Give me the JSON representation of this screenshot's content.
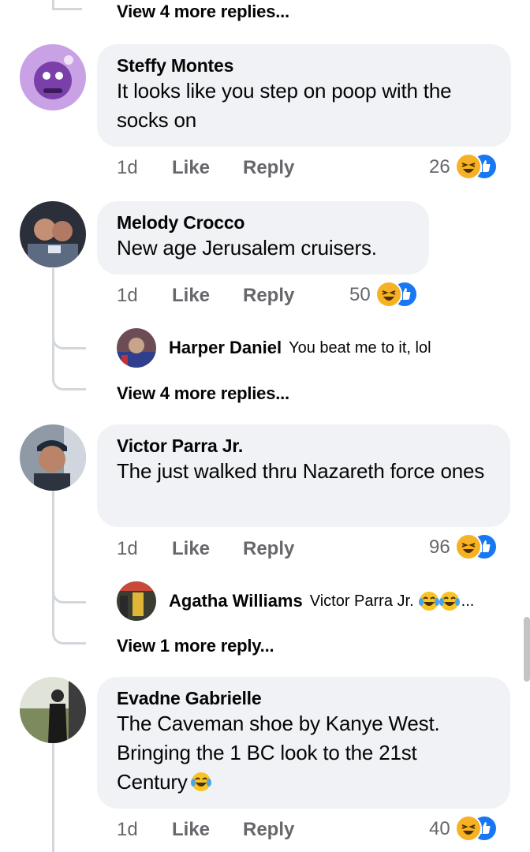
{
  "top_more": {
    "label": "View 4 more replies..."
  },
  "comments": [
    {
      "author": "Steffy Montes",
      "text": "It looks like you step on poop with the socks on",
      "time": "1d",
      "like": "Like",
      "reply": "Reply",
      "reactions": "26"
    },
    {
      "author": "Melody Crocco",
      "text": "New age Jerusalem cruisers.",
      "time": "1d",
      "like": "Like",
      "reply": "Reply",
      "reactions": "50",
      "sub_reply": {
        "author": "Harper Daniel",
        "text": "You beat me to it, lol"
      },
      "more": "View 4 more replies..."
    },
    {
      "author": "Victor Parra Jr.",
      "text": "The just walked thru Nazareth force ones",
      "time": "1d",
      "like": "Like",
      "reply": "Reply",
      "reactions": "96",
      "sub_reply": {
        "author": "Agatha Williams",
        "text": "Victor Parra Jr.",
        "suffix": "..."
      },
      "more": "View 1 more reply..."
    },
    {
      "author": "Evadne Gabrielle",
      "text": "The Caveman shoe by Kanye West. Bringing the 1 BC look to the 21st Century",
      "time": "1d",
      "like": "Like",
      "reply": "Reply",
      "reactions": "40"
    }
  ],
  "colors": {
    "like_blue": "#1877f2",
    "haha_yellow": "#f7b125",
    "bubble": "#f0f2f5",
    "meta_grey": "#65676b"
  },
  "icons": [
    "haha-reaction-icon",
    "like-reaction-icon",
    "tears-of-joy-emoji"
  ]
}
